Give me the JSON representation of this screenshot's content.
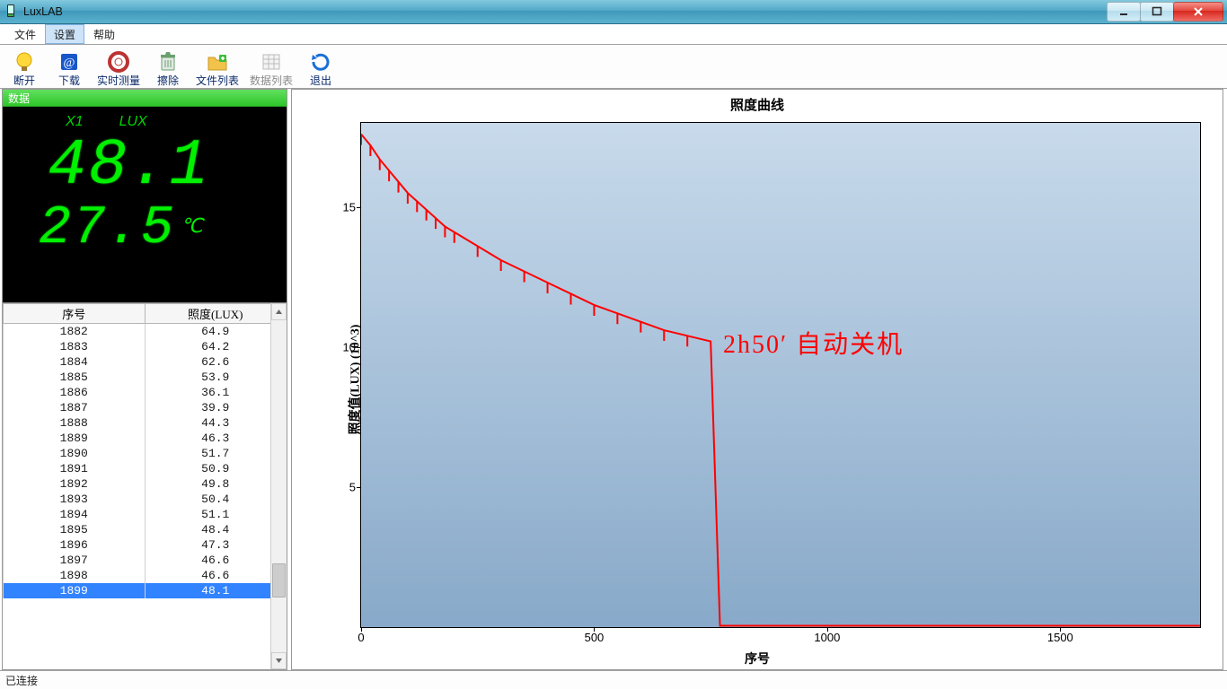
{
  "title": "LuxLAB",
  "menu": {
    "file": "文件",
    "settings": "设置",
    "help": "帮助"
  },
  "toolbar": {
    "disconnect": "断开",
    "download": "下载",
    "realtime": "实时测量",
    "erase": "擦除",
    "filelist": "文件列表",
    "datalist": "数据列表",
    "exit": "退出"
  },
  "sidebar": {
    "header": "数据",
    "mode": "X1",
    "unit": "LUX",
    "lux_value": "48.1",
    "temp_value": "27.5",
    "temp_unit": "℃",
    "columns": {
      "seq": "序号",
      "lux": "照度(LUX)"
    },
    "rows": [
      {
        "seq": "1882",
        "lux": "64.9"
      },
      {
        "seq": "1883",
        "lux": "64.2"
      },
      {
        "seq": "1884",
        "lux": "62.6"
      },
      {
        "seq": "1885",
        "lux": "53.9"
      },
      {
        "seq": "1886",
        "lux": "36.1"
      },
      {
        "seq": "1887",
        "lux": "39.9"
      },
      {
        "seq": "1888",
        "lux": "44.3"
      },
      {
        "seq": "1889",
        "lux": "46.3"
      },
      {
        "seq": "1890",
        "lux": "51.7"
      },
      {
        "seq": "1891",
        "lux": "50.9"
      },
      {
        "seq": "1892",
        "lux": "49.8"
      },
      {
        "seq": "1893",
        "lux": "50.4"
      },
      {
        "seq": "1894",
        "lux": "51.1"
      },
      {
        "seq": "1895",
        "lux": "48.4"
      },
      {
        "seq": "1896",
        "lux": "47.3"
      },
      {
        "seq": "1897",
        "lux": "46.6"
      },
      {
        "seq": "1898",
        "lux": "46.6"
      },
      {
        "seq": "1899",
        "lux": "48.1"
      }
    ],
    "selected_index": 17
  },
  "chart": {
    "title": "照度曲线",
    "ylabel": "照度值(LUX) (10^3)",
    "xlabel": "序号",
    "annotation": "2h50′ 自动关机",
    "yticks": [
      "5",
      "10",
      "15"
    ],
    "xticks": [
      "0",
      "500",
      "1000",
      "1500"
    ]
  },
  "chart_data": {
    "type": "line",
    "title": "照度曲线",
    "xlabel": "序号",
    "ylabel": "照度值(LUX) (10^3)",
    "xlim": [
      0,
      1800
    ],
    "ylim": [
      0,
      18
    ],
    "annotation": {
      "text": "2h50′ 自动关机",
      "x": 1000,
      "y": 10.5
    },
    "x": [
      0,
      20,
      40,
      60,
      80,
      100,
      120,
      140,
      160,
      180,
      200,
      250,
      300,
      350,
      400,
      450,
      500,
      550,
      600,
      650,
      700,
      750,
      770,
      1800
    ],
    "y": [
      17.6,
      17.2,
      16.7,
      16.3,
      15.9,
      15.5,
      15.2,
      14.9,
      14.6,
      14.3,
      14.1,
      13.6,
      13.1,
      12.7,
      12.3,
      11.9,
      11.5,
      11.2,
      10.9,
      10.6,
      10.4,
      10.2,
      0.05,
      0.05
    ]
  },
  "status": {
    "text": "已连接"
  }
}
